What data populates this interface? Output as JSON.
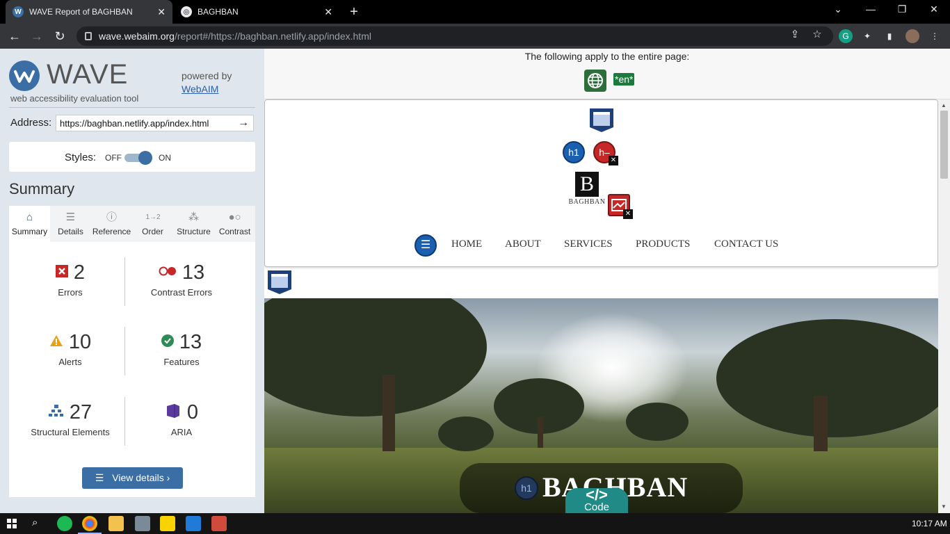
{
  "browser": {
    "tabs": [
      {
        "title": "WAVE Report of BAGHBAN",
        "active": true
      },
      {
        "title": "BAGHBAN",
        "active": false
      }
    ],
    "url_host": "wave.webaim.org",
    "url_path": "/report#/https://baghban.netlify.app/index.html"
  },
  "wave": {
    "logo_word": "WAVE",
    "subtitle": "web accessibility evaluation tool",
    "powered_by": "powered by",
    "webaim": "WebAIM",
    "address_label": "Address:",
    "address_value": "https://baghban.netlify.app/index.html",
    "styles_label": "Styles:",
    "toggle_off": "OFF",
    "toggle_on": "ON",
    "summary_heading": "Summary",
    "tabs": [
      {
        "label": "Summary",
        "icon": "home-icon"
      },
      {
        "label": "Details",
        "icon": "list-icon"
      },
      {
        "label": "Reference",
        "icon": "info-icon"
      },
      {
        "label": "Order",
        "icon": "order-icon"
      },
      {
        "label": "Structure",
        "icon": "structure-icon"
      },
      {
        "label": "Contrast",
        "icon": "contrast-icon"
      }
    ],
    "stats": {
      "errors": {
        "value": "2",
        "label": "Errors"
      },
      "contrast": {
        "value": "13",
        "label": "Contrast Errors"
      },
      "alerts": {
        "value": "10",
        "label": "Alerts"
      },
      "features": {
        "value": "13",
        "label": "Features"
      },
      "structural": {
        "value": "27",
        "label": "Structural Elements"
      },
      "aria": {
        "value": "0",
        "label": "ARIA"
      }
    },
    "view_details": "View details ›"
  },
  "page": {
    "entire_page_text": "The following apply to the entire page:",
    "lang_badge": "*en*",
    "logo_text": "BAGHBAN",
    "nav": [
      "HOME",
      "ABOUT",
      "SERVICES",
      "PRODUCTS",
      "CONTACT US"
    ],
    "hero_title": "BAGHBAN",
    "code_button": "Code",
    "code_glyph": "</>",
    "h1_badge": "h1",
    "hminus_badge": "h–"
  },
  "taskbar": {
    "time": "10:17 AM"
  },
  "colors": {
    "wave_blue": "#3a6ea5",
    "error_red": "#c62828",
    "alert_orange": "#e6a118",
    "feature_green": "#2e8b57",
    "aria_purple": "#5b3a9e"
  }
}
